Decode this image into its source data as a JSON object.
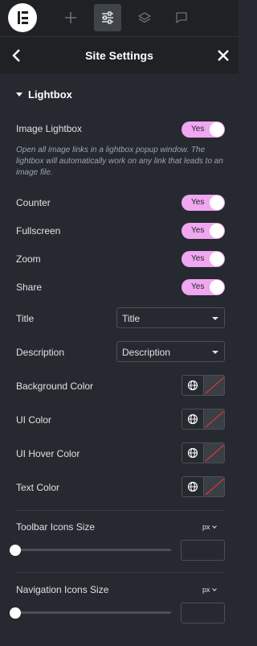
{
  "topbar": {
    "icons": [
      "elementor-logo-icon",
      "plus-icon",
      "sliders-icon",
      "layers-icon",
      "chat-icon"
    ]
  },
  "header": {
    "title": "Site Settings",
    "back_icon": "chevron-left-icon",
    "close_icon": "close-icon"
  },
  "section": {
    "title": "Lightbox"
  },
  "image_lightbox": {
    "label": "Image Lightbox",
    "value": "Yes",
    "description": "Open all image links in a lightbox popup window. The lightbox will automatically work on any link that leads to an image file."
  },
  "toggles": [
    {
      "label": "Counter",
      "value": "Yes"
    },
    {
      "label": "Fullscreen",
      "value": "Yes"
    },
    {
      "label": "Zoom",
      "value": "Yes"
    },
    {
      "label": "Share",
      "value": "Yes"
    }
  ],
  "selects": [
    {
      "label": "Title",
      "value": "Title"
    },
    {
      "label": "Description",
      "value": "Description"
    }
  ],
  "colors": [
    {
      "label": "Background Color"
    },
    {
      "label": "UI Color"
    },
    {
      "label": "UI Hover Color"
    },
    {
      "label": "Text Color"
    }
  ],
  "sliders": [
    {
      "label": "Toolbar Icons Size",
      "unit": "px",
      "value": ""
    },
    {
      "label": "Navigation Icons Size",
      "unit": "px",
      "value": ""
    }
  ],
  "theme": {
    "toggle_on": "#f0a6f0",
    "panel_bg": "#26292f",
    "bar_bg": "#1f2124"
  }
}
